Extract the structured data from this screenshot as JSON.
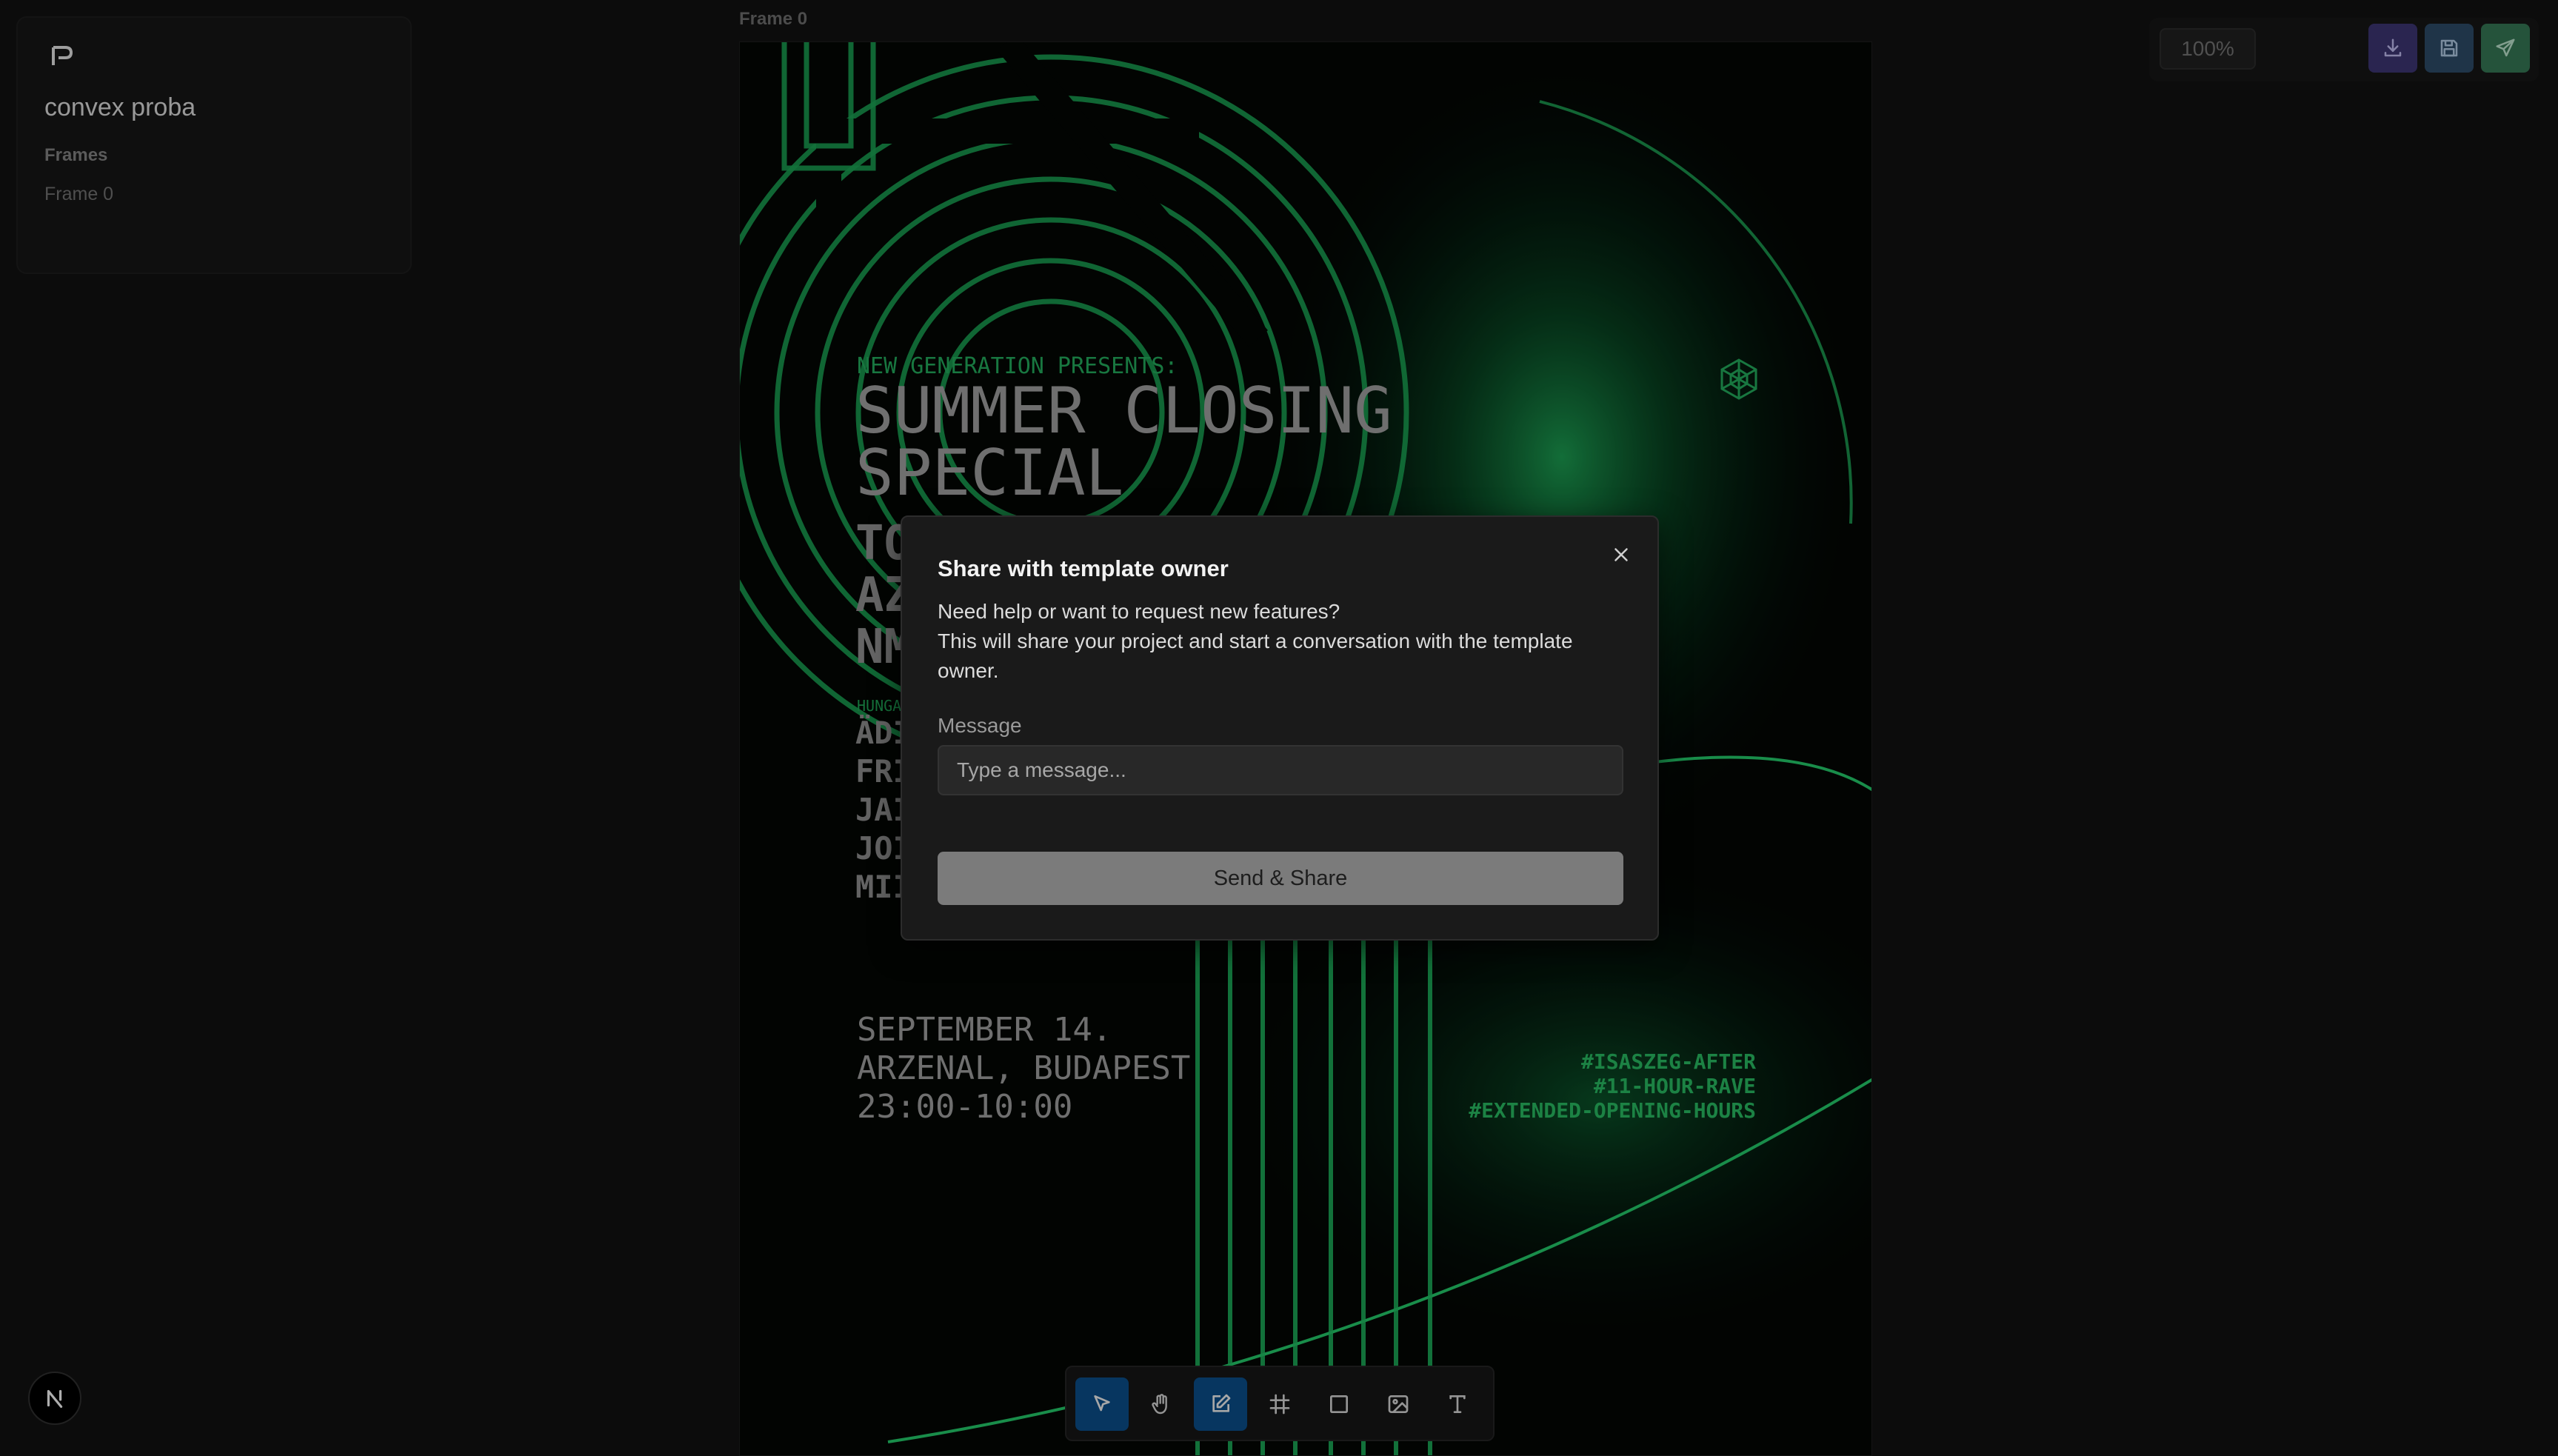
{
  "sidebar": {
    "app_title": "convex proba",
    "frames_heading": "Frames",
    "frames": [
      "Frame 0"
    ]
  },
  "canvas": {
    "frame_label": "Frame 0"
  },
  "poster": {
    "presents": "NEW GENERATION PRESENTS:",
    "title_line1": "SUMMER CLOSING",
    "title_line2": "SPECIAL",
    "big_lines": [
      "TO",
      "AZ",
      "NM"
    ],
    "hungary_label": "HUNGA",
    "artists": [
      "ÄDI",
      "FRI",
      "JAI",
      "JOI",
      "MII"
    ],
    "date_line1": "SEPTEMBER 14.",
    "date_line2": "ARZENAL, BUDAPEST",
    "date_line3": "23:00-10:00",
    "tags": [
      "#ISASZEG-AFTER",
      "#11-HOUR-RAVE",
      "#EXTENDED-OPENING-HOURS"
    ],
    "accent_color": "#27b55f"
  },
  "topbar": {
    "zoom": "100%",
    "download_icon": "download-icon",
    "save_icon": "save-icon",
    "send_icon": "send-icon"
  },
  "modal": {
    "title": "Share with template owner",
    "description_line1": "Need help or want to request new features?",
    "description_line2": "This will share your project and start a conversation with the template owner.",
    "message_label": "Message",
    "message_placeholder": "Type a message...",
    "message_value": "",
    "submit_label": "Send & Share"
  },
  "toolbar": {
    "tools": [
      "select-tool",
      "hand-tool",
      "edit-tool",
      "frame-tool",
      "rectangle-tool",
      "image-tool",
      "text-tool"
    ],
    "active_tools": [
      "select-tool",
      "edit-tool"
    ],
    "active_color": "#0a4c85"
  },
  "badge": {
    "letter": "N"
  }
}
